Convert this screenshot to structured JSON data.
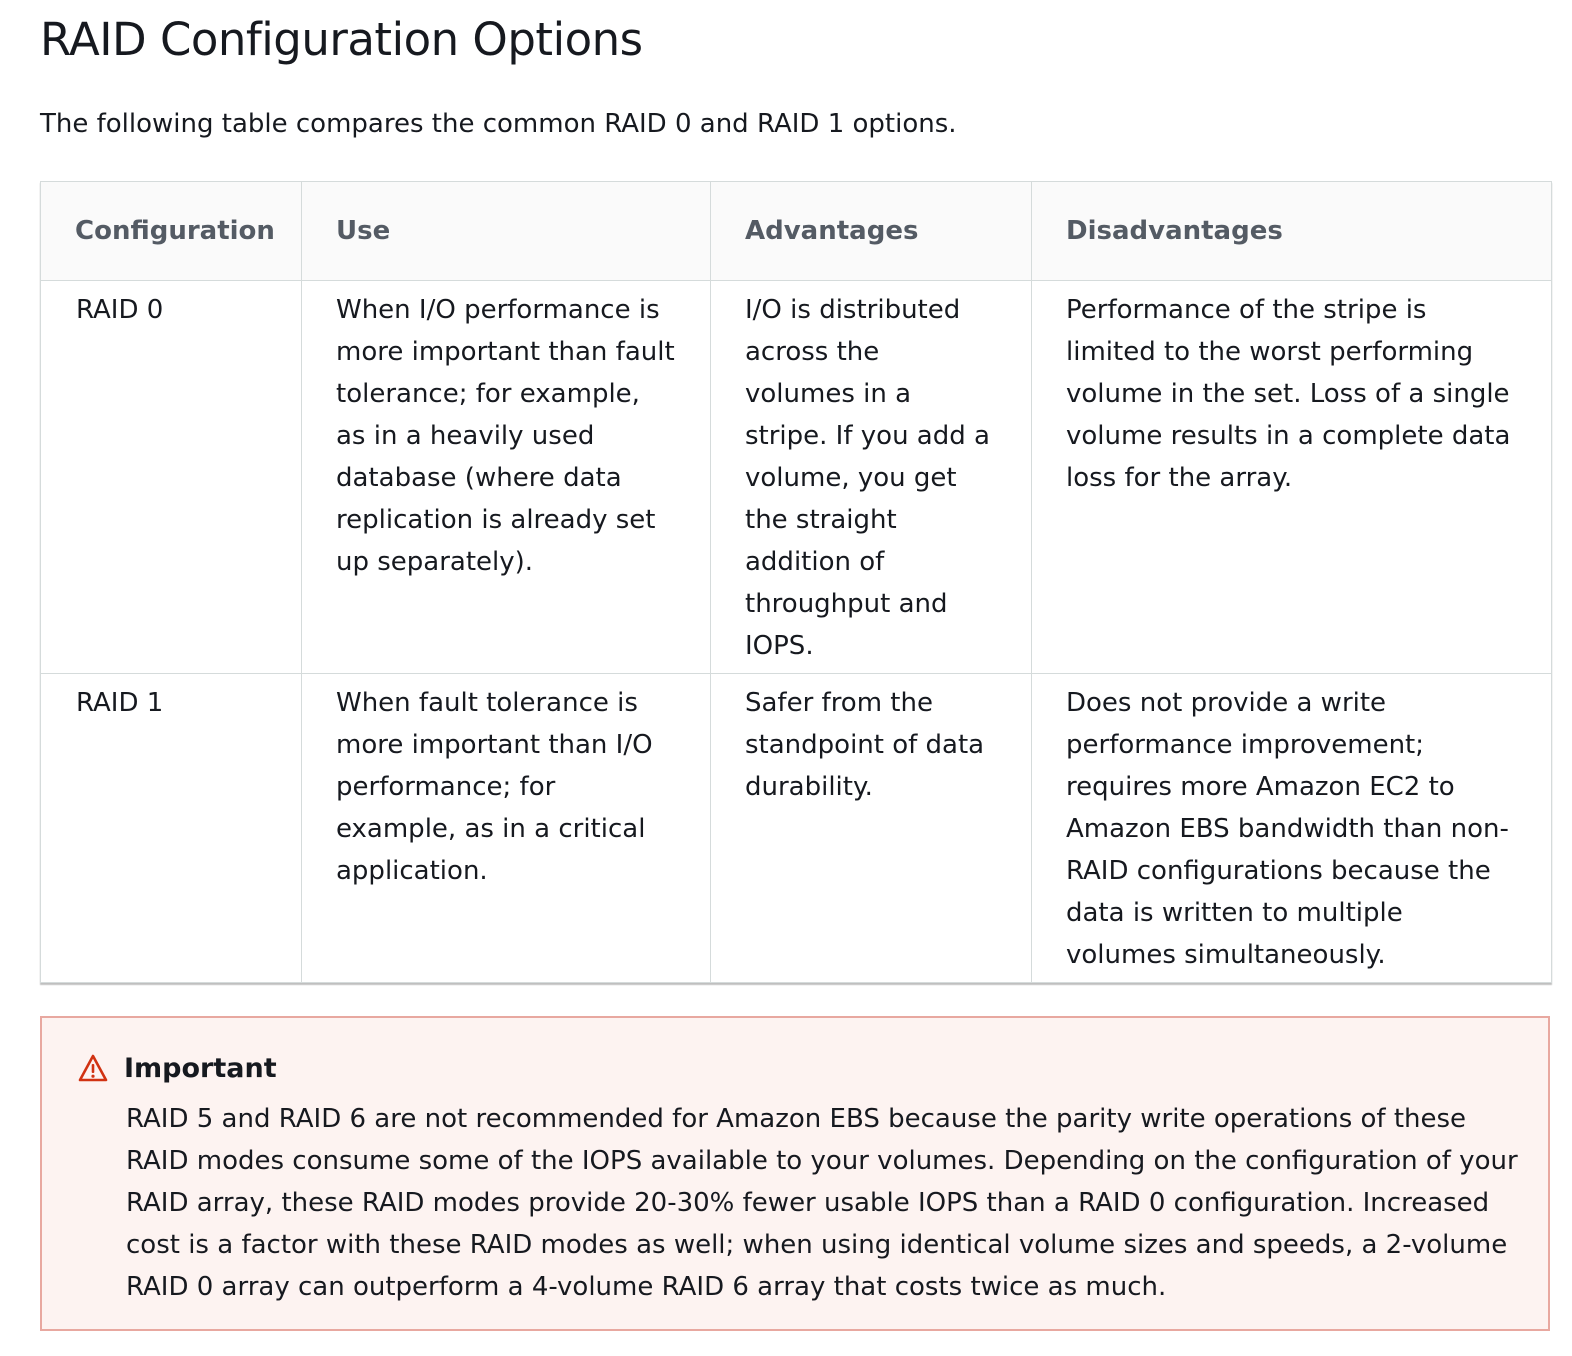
{
  "page": {
    "title": "RAID Configuration Options",
    "intro": "The following table compares the common RAID 0 and RAID 1 options."
  },
  "table": {
    "headers": [
      "Configuration",
      "Use",
      "Advantages",
      "Disadvantages"
    ],
    "rows": [
      {
        "configuration": "RAID 0",
        "use": "When I/O performance is more important than fault tolerance; for example, as in a heavily used database (where data replication is already set up separately).",
        "advantages": "I/O is distributed across the volumes in a stripe. If you add a volume, you get the straight addition of throughput and IOPS.",
        "disadvantages": "Performance of the stripe is limited to the worst performing volume in the set. Loss of a single volume results in a complete data loss for the array."
      },
      {
        "configuration": "RAID 1",
        "use": "When fault tolerance is more important than I/O performance; for example, as in a critical application.",
        "advantages": "Safer from the standpoint of data durability.",
        "disadvantages": "Does not provide a write performance improvement; requires more Amazon EC2 to Amazon EBS bandwidth than non-RAID configurations because the data is written to multiple volumes simultaneously."
      }
    ]
  },
  "callout": {
    "icon": "warning-icon",
    "title": "Important",
    "body": "RAID 5 and RAID 6 are not recommended for Amazon EBS because the parity write operations of these RAID modes consume some of the IOPS available to your volumes. Depending on the configuration of your RAID array, these RAID modes provide 20-30% fewer usable IOPS than a RAID 0 configuration. Increased cost is a factor with these RAID modes as well; when using identical volume sizes and speeds, a 2-volume RAID 0 array can outperform a 4-volume RAID 6 array that costs twice as much."
  },
  "colors": {
    "header_text": "#545b64",
    "body_text": "#16191f",
    "border": "#d5dbdb",
    "callout_background": "#fdf3f1",
    "callout_border": "#e8a8a0",
    "warning_icon": "#d13212"
  }
}
